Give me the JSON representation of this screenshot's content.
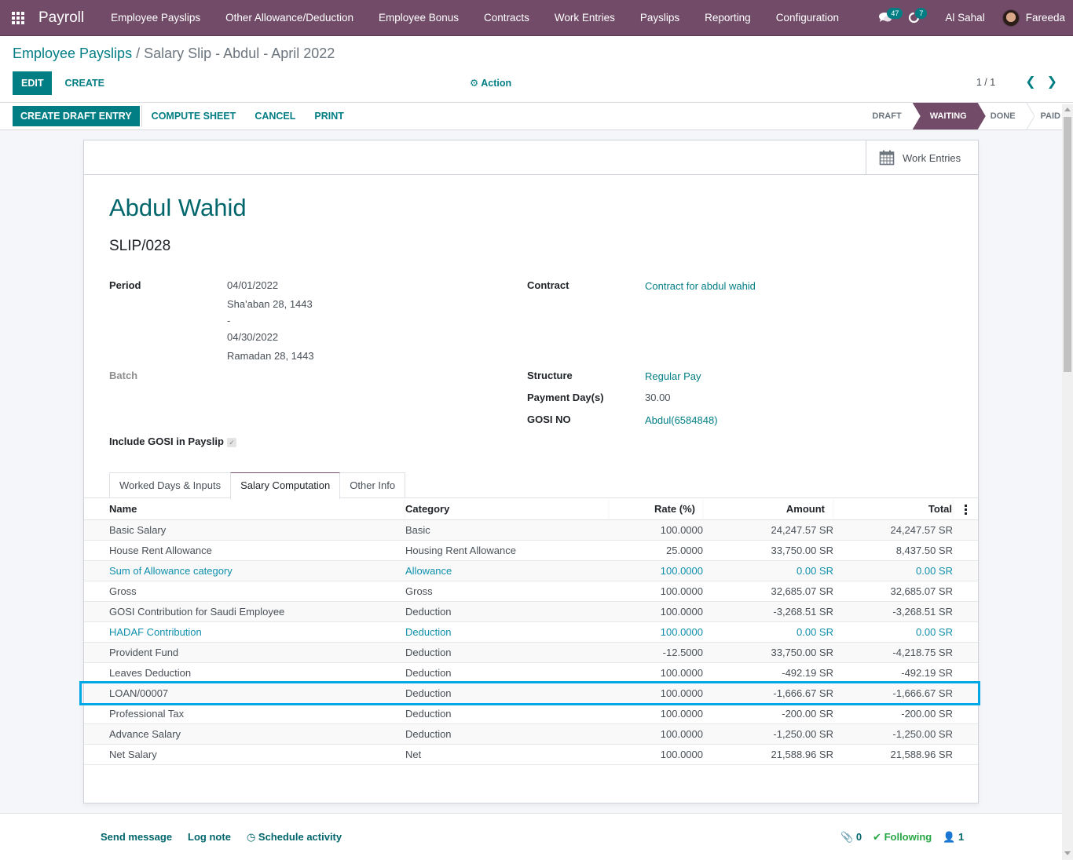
{
  "navbar": {
    "app_name": "Payroll",
    "menu": [
      {
        "label": "Employee Payslips"
      },
      {
        "label": "Other Allowance/Deduction"
      },
      {
        "label": "Employee Bonus"
      },
      {
        "label": "Contracts"
      },
      {
        "label": "Work Entries"
      },
      {
        "label": "Payslips"
      },
      {
        "label": "Reporting"
      },
      {
        "label": "Configuration"
      }
    ],
    "messages_count": "47",
    "activities_count": "7",
    "company": "Al Sahal",
    "user": "Fareeda",
    "brand_color": "#714B67"
  },
  "breadcrumb": {
    "parent": "Employee Payslips",
    "separator": "/",
    "current": "Salary Slip - Abdul - April 2022"
  },
  "control_panel": {
    "edit_label": "EDIT",
    "create_label": "CREATE",
    "action_label": "Action",
    "pager_value": "1 / 1"
  },
  "status_bar": {
    "buttons": [
      {
        "label": "CREATE DRAFT ENTRY",
        "primary": true
      },
      {
        "label": "COMPUTE SHEET"
      },
      {
        "label": "CANCEL"
      },
      {
        "label": "PRINT"
      }
    ],
    "stages": [
      {
        "label": "DRAFT"
      },
      {
        "label": "WAITING",
        "active": true
      },
      {
        "label": "DONE"
      },
      {
        "label": "PAID"
      }
    ]
  },
  "sheet": {
    "stat_button": "Work Entries",
    "employee_name": "Abdul Wahid",
    "slip_number": "SLIP/028",
    "fields": {
      "period_label": "Period",
      "period_start": "04/01/2022",
      "period_start_hijri": "Sha'aban 28, 1443",
      "period_sep": "-",
      "period_end": "04/30/2022",
      "period_end_hijri": "Ramadan 28, 1443",
      "batch_label": "Batch",
      "include_gosi_label": "Include GOSI in Payslip",
      "include_gosi_checked": true,
      "contract_label": "Contract",
      "contract_value": "Contract for abdul wahid",
      "structure_label": "Structure",
      "structure_value": "Regular Pay",
      "payment_days_label": "Payment Day(s)",
      "payment_days_value": "30.00",
      "gosi_no_label": "GOSI NO",
      "gosi_no_value": "Abdul(6584848)"
    },
    "tabs": [
      {
        "label": "Worked Days & Inputs"
      },
      {
        "label": "Salary Computation",
        "active": true
      },
      {
        "label": "Other Info"
      }
    ],
    "table": {
      "columns": [
        "Name",
        "Category",
        "Rate (%)",
        "Amount",
        "Total"
      ],
      "rows": [
        {
          "name": "Basic Salary",
          "category": "Basic",
          "rate": "100.0000",
          "amount": "24,247.57 SR",
          "total": "24,247.57 SR"
        },
        {
          "name": "House Rent Allowance",
          "category": "Housing Rent Allowance",
          "rate": "25.0000",
          "amount": "33,750.00 SR",
          "total": "8,437.50 SR"
        },
        {
          "name": "Sum of Allowance category",
          "category": "Allowance",
          "rate": "100.0000",
          "amount": "0.00 SR",
          "total": "0.00 SR",
          "muted": true
        },
        {
          "name": "Gross",
          "category": "Gross",
          "rate": "100.0000",
          "amount": "32,685.07 SR",
          "total": "32,685.07 SR"
        },
        {
          "name": "GOSI Contribution for Saudi Employee",
          "category": "Deduction",
          "rate": "100.0000",
          "amount": "-3,268.51 SR",
          "total": "-3,268.51 SR"
        },
        {
          "name": "HADAF Contribution",
          "category": "Deduction",
          "rate": "100.0000",
          "amount": "0.00 SR",
          "total": "0.00 SR",
          "muted": true
        },
        {
          "name": "Provident Fund",
          "category": "Deduction",
          "rate": "-12.5000",
          "amount": "33,750.00 SR",
          "total": "-4,218.75 SR"
        },
        {
          "name": "Leaves Deduction",
          "category": "Deduction",
          "rate": "100.0000",
          "amount": "-492.19 SR",
          "total": "-492.19 SR"
        },
        {
          "name": "LOAN/00007",
          "category": "Deduction",
          "rate": "100.0000",
          "amount": "-1,666.67 SR",
          "total": "-1,666.67 SR",
          "highlighted": true
        },
        {
          "name": "Professional Tax",
          "category": "Deduction",
          "rate": "100.0000",
          "amount": "-200.00 SR",
          "total": "-200.00 SR"
        },
        {
          "name": "Advance Salary",
          "category": "Deduction",
          "rate": "100.0000",
          "amount": "-1,250.00 SR",
          "total": "-1,250.00 SR"
        },
        {
          "name": "Net Salary",
          "category": "Net",
          "rate": "100.0000",
          "amount": "21,588.96 SR",
          "total": "21,588.96 SR"
        }
      ]
    }
  },
  "chatter": {
    "send_message": "Send message",
    "log_note": "Log note",
    "schedule_activity": "Schedule activity",
    "attachments_count": "0",
    "following_label": "Following",
    "followers_count": "1"
  }
}
